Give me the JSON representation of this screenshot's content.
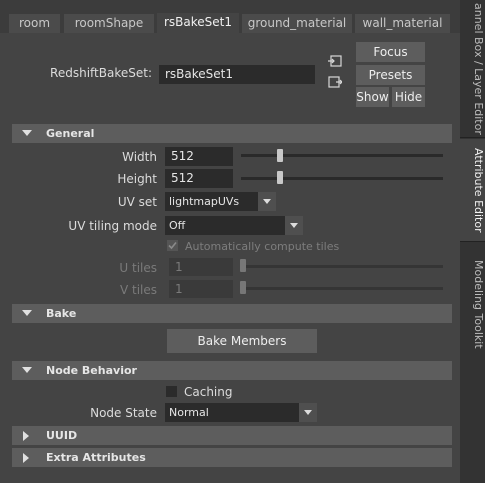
{
  "tabs": [
    {
      "label": "room"
    },
    {
      "label": "roomShape"
    },
    {
      "label": "rsBakeSet1"
    },
    {
      "label": "ground_material"
    },
    {
      "label": "wall_material"
    }
  ],
  "right_tabs": {
    "channel_box": "annel Box / Layer Editor",
    "attribute_editor": "Attribute Editor",
    "modeling_toolkit": "Modeling Toolkit"
  },
  "node": {
    "type_label": "RedshiftBakeSet:",
    "name_value": "rsBakeSet1"
  },
  "buttons": {
    "focus": "Focus",
    "presets": "Presets",
    "show": "Show",
    "hide": "Hide",
    "bake_members": "Bake Members"
  },
  "sections": {
    "general": "General",
    "bake": "Bake",
    "node_behavior": "Node Behavior",
    "uuid": "UUID",
    "extra_attributes": "Extra Attributes"
  },
  "general": {
    "width_label": "Width",
    "width_value": "512",
    "width_level": 0.15,
    "height_label": "Height",
    "height_value": "512",
    "height_level": 0.15,
    "uvset_label": "UV set",
    "uvset_value": "lightmapUVs",
    "uvtiling_label": "UV tiling mode",
    "uvtiling_value": "Off",
    "auto_tiles_label": "Automatically compute tiles",
    "auto_tiles_checked": true,
    "utiles_label": "U tiles",
    "utiles_value": "1",
    "vtiles_label": "V tiles",
    "vtiles_value": "1"
  },
  "node_behavior": {
    "caching_label": "Caching",
    "caching_checked": false,
    "node_state_label": "Node State",
    "node_state_value": "Normal"
  }
}
